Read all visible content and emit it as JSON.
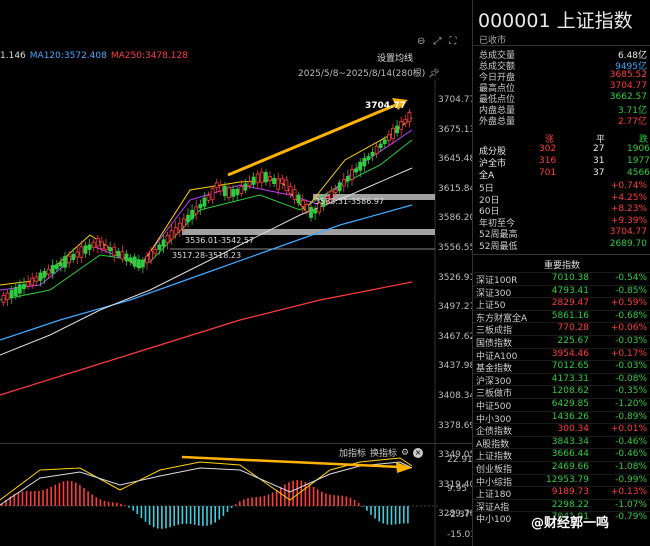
{
  "chart": {
    "ma_items": [
      {
        "text": "1.146",
        "color": "#dddddd"
      },
      {
        "text": "MA120:3572.408",
        "color": "#3fa9ff"
      },
      {
        "text": "MA250:3478.128",
        "color": "#ff3b3b"
      }
    ],
    "settings_label": "设置均线",
    "date_range": "2025/5/8~2025/8/14(280根)",
    "peak_label": "3704.77",
    "band_labels": [
      "3583.31-3586.97",
      "3536.01-3542.57",
      "3517.28-3518.23"
    ],
    "price_ticks": [
      "3704.77",
      "3675.13",
      "3645.48",
      "3615.84",
      "3586.20",
      "3556.55",
      "3526.91",
      "3497.27",
      "3467.62",
      "3437.98",
      "3408.34",
      "3378.69",
      "3349.05",
      "3319.40",
      "3289.76"
    ],
    "sub_header": {
      "add": "加指标",
      "switch": "换指标"
    },
    "sub_ticks": [
      "22.91",
      "9.95",
      "-2.37",
      "-15.01"
    ],
    "colors": {
      "up": "#ff3b3b",
      "down": "#2ecc40",
      "ma120": "#3fa9ff",
      "ma250": "#ff3b3b",
      "arrow": "#ffb300"
    }
  },
  "panel": {
    "code": "000001",
    "name": "上证指数",
    "status": "已收市",
    "stats": [
      {
        "label": "总成交量",
        "value": "6.48亿",
        "color": "white"
      },
      {
        "label": "总成交额",
        "value": "9495亿",
        "color": "blue"
      },
      {
        "label": "今日开盘",
        "value": "3685.52",
        "color": "red"
      },
      {
        "label": "最高点位",
        "value": "3704.77",
        "color": "red"
      },
      {
        "label": "最低点位",
        "value": "3662.57",
        "color": "green"
      },
      {
        "label": "内盘总量",
        "value": "3.71亿",
        "color": "green"
      },
      {
        "label": "外盘总量",
        "value": "2.77亿",
        "color": "red"
      }
    ],
    "breadth_header": {
      "up": "涨",
      "flat": "平",
      "down": "跌"
    },
    "breadth": [
      {
        "label": "成分股",
        "up": "302",
        "flat": "27",
        "down": "1906"
      },
      {
        "label": "沪全市",
        "up": "316",
        "flat": "31",
        "down": "1977"
      },
      {
        "label": "全A",
        "up": "701",
        "flat": "37",
        "down": "4566"
      }
    ],
    "periods": [
      {
        "label": "5日",
        "value": "+0.74%",
        "color": "red"
      },
      {
        "label": "20日",
        "value": "+4.25%",
        "color": "red"
      },
      {
        "label": "60日",
        "value": "+8.23%",
        "color": "red"
      },
      {
        "label": "年初至今",
        "value": "+9.39%",
        "color": "red"
      },
      {
        "label": "52周最高",
        "value": "3704.77",
        "color": "red"
      },
      {
        "label": "52周最低",
        "value": "2689.70",
        "color": "green"
      }
    ],
    "index_title": "重要指数",
    "indices": [
      {
        "name": "深证100R",
        "price": "7010.38",
        "change": "-0.54%",
        "color": "green"
      },
      {
        "name": "深证300",
        "price": "4793.41",
        "change": "-0.85%",
        "color": "green"
      },
      {
        "name": "上证50",
        "price": "2829.47",
        "change": "+0.59%",
        "color": "red"
      },
      {
        "name": "东方财富全A",
        "price": "5861.16",
        "change": "-0.68%",
        "color": "green"
      },
      {
        "name": "三板成指",
        "price": "770.28",
        "change": "+0.06%",
        "color": "red"
      },
      {
        "name": "国债指数",
        "price": "225.67",
        "change": "-0.03%",
        "color": "green"
      },
      {
        "name": "中证A100",
        "price": "3954.46",
        "change": "+0.17%",
        "color": "red"
      },
      {
        "name": "基金指数",
        "price": "7012.65",
        "change": "-0.03%",
        "color": "green"
      },
      {
        "name": "沪深300",
        "price": "4173.31",
        "change": "-0.08%",
        "color": "green"
      },
      {
        "name": "三板做市",
        "price": "1208.62",
        "change": "-0.35%",
        "color": "green"
      },
      {
        "name": "中证500",
        "price": "6429.85",
        "change": "-1.20%",
        "color": "green"
      },
      {
        "name": "中小300",
        "price": "1436.26",
        "change": "-0.89%",
        "color": "green"
      },
      {
        "name": "企债指数",
        "price": "300.34",
        "change": "+0.01%",
        "color": "red"
      },
      {
        "name": "A股指数",
        "price": "3843.34",
        "change": "-0.46%",
        "color": "green"
      },
      {
        "name": "上证指数",
        "price": "3666.44",
        "change": "-0.46%",
        "color": "green"
      },
      {
        "name": "创业板指",
        "price": "2469.66",
        "change": "-1.08%",
        "color": "green"
      },
      {
        "name": "中小综指",
        "price": "12953.79",
        "change": "-0.99%",
        "color": "green"
      },
      {
        "name": "上证180",
        "price": "9189.73",
        "change": "+0.13%",
        "color": "red"
      },
      {
        "name": "深证A指",
        "price": "2298.22",
        "change": "-1.07%",
        "color": "green"
      },
      {
        "name": "中小100",
        "price": "7041.91",
        "change": "-0.79%",
        "color": "green"
      }
    ],
    "watermark": "@财经郭一鸣"
  }
}
